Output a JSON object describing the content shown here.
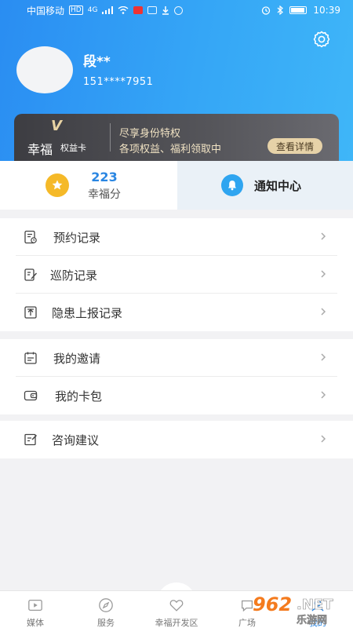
{
  "status_bar": {
    "carrier": "中国移动",
    "hd_badge": "HD",
    "network": "4G",
    "time": "10:39"
  },
  "profile": {
    "name": "段**",
    "phone": "151****7951"
  },
  "vip_card": {
    "logo_letter": "V",
    "brand": "幸福",
    "brand_sub": "权益卡",
    "line1": "尽享身份特权",
    "line2": "各项权益、福利领取中",
    "button": "查看详情"
  },
  "stats": {
    "points_value": "223",
    "points_label": "幸福分",
    "notify_label": "通知中心"
  },
  "menu_groups": [
    [
      {
        "label": "预约记录",
        "icon": "appointment-icon"
      },
      {
        "label": "巡防记录",
        "icon": "patrol-icon"
      },
      {
        "label": "隐患上报记录",
        "icon": "hazard-report-icon"
      }
    ],
    [
      {
        "label": "我的邀请",
        "icon": "invitation-icon"
      },
      {
        "label": "我的卡包",
        "icon": "wallet-icon"
      }
    ],
    [
      {
        "label": "咨询建议",
        "icon": "feedback-icon"
      }
    ]
  ],
  "tabbar": {
    "items": [
      {
        "label": "媒体",
        "icon": "media-icon"
      },
      {
        "label": "服务",
        "icon": "service-icon"
      },
      {
        "label": "幸福开发区",
        "icon": "heart-icon"
      },
      {
        "label": "广场",
        "icon": "square-icon"
      },
      {
        "label": "我的",
        "icon": "profile-icon"
      }
    ],
    "active_index": 4
  },
  "watermark": {
    "brand": "962.NET",
    "sub": "乐游网"
  },
  "colors": {
    "header_start": "#2a8df2",
    "header_end": "#3fb6f8",
    "accent_blue": "#2a86e2",
    "star_gold": "#f5b928",
    "vip_gold": "#e6d2a8",
    "watermark_orange": "#f47b1e"
  }
}
